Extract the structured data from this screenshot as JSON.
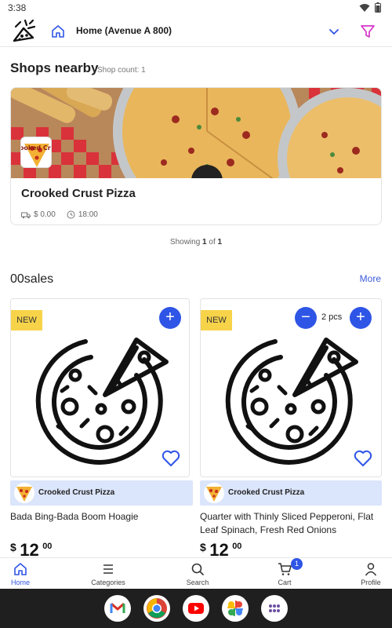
{
  "status_bar": {
    "time": "3:38"
  },
  "header": {
    "address": "Home (Avenue A 800)"
  },
  "shops_section": {
    "title": "Shops nearby",
    "count_label": "Shop count: 1",
    "shop": {
      "name": "Crooked Crust Pizza",
      "logo_text": "Crooked Crust",
      "delivery_fee": "$ 0.00",
      "time": "18:00"
    },
    "pagination": {
      "prefix": "Showing",
      "current": "1",
      "of": "of",
      "total": "1"
    }
  },
  "sales_section": {
    "title": "00sales",
    "more_label": "More",
    "products": [
      {
        "badge": "NEW",
        "shop_name": "Crooked Crust Pizza",
        "name": "Bada Bing-Bada Boom Hoagie",
        "currency": "$",
        "price_int": "12",
        "price_dec": "00"
      },
      {
        "badge": "NEW",
        "shop_name": "Crooked Crust Pizza",
        "name": "Quarter with Thinly Sliced Pepperoni, Flat Leaf Spinach, Fresh Red Onions",
        "currency": "$",
        "price_int": "12",
        "price_dec": "00",
        "quantity": "2 pcs"
      }
    ]
  },
  "bottom_nav": {
    "items": [
      {
        "label": "Home",
        "icon": "home-icon",
        "active": true
      },
      {
        "label": "Categories",
        "icon": "list-icon"
      },
      {
        "label": "Search",
        "icon": "search-icon"
      },
      {
        "label": "Cart",
        "icon": "cart-icon",
        "badge": "1"
      },
      {
        "label": "Profile",
        "icon": "person-icon"
      }
    ]
  },
  "dock": {
    "apps": [
      "gmail-icon",
      "chrome-icon",
      "youtube-icon",
      "photos-icon",
      "app-drawer-icon"
    ]
  },
  "colors": {
    "accent": "#2f55e6",
    "new_badge": "#f7d34a",
    "shop_tag_bg": "#dbe5fb",
    "filter_icon": "#d633c9"
  }
}
